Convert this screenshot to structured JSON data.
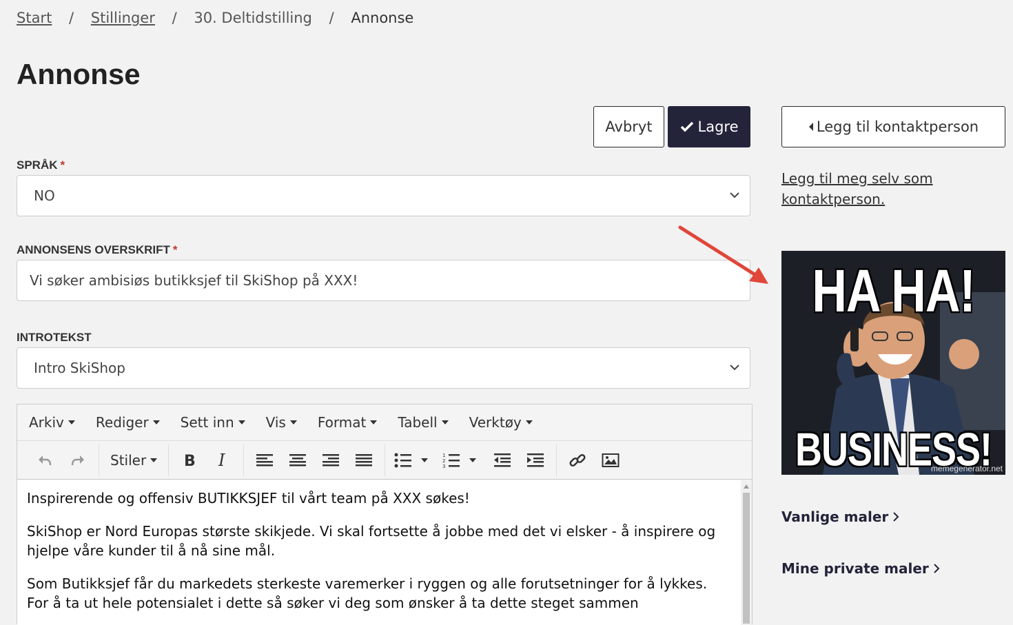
{
  "breadcrumb": {
    "items": [
      "Start",
      "Stillinger",
      "30. Deltidstilling",
      "Annonse"
    ],
    "separator": "/"
  },
  "page": {
    "title": "Annonse"
  },
  "actions": {
    "cancel_label": "Avbryt",
    "save_label": "Lagre",
    "add_contact_label": "Legg til kontaktperson",
    "add_self_link": "Legg til meg selv som kontaktperson."
  },
  "form": {
    "language": {
      "label": "SPRÅK",
      "required_mark": "*",
      "value": "NO"
    },
    "headline": {
      "label": "ANNONSENS OVERSKRIFT",
      "required_mark": "*",
      "value": "Vi søker ambisiøs butikksjef til SkiShop på XXX!"
    },
    "intro": {
      "label": "INTROTEKST",
      "value": "Intro SkiShop"
    }
  },
  "editor": {
    "menu": [
      "Arkiv",
      "Rediger",
      "Sett inn",
      "Vis",
      "Format",
      "Tabell",
      "Verktøy"
    ],
    "styles_label": "Stiler",
    "paragraphs": [
      "Inspirerende og offensiv BUTIKKSJEF til vårt team på XXX søkes!",
      "SkiShop er Nord Europas største skikjede. Vi skal fortsette å jobbe med det vi elsker - å inspirere og hjelpe våre kunder til å nå sine mål.",
      "Som Butikksjef får du markedets sterkeste varemerker i ryggen og alle forutsetninger for å lykkes. For å ta ut hele potensialet i dette så søker vi deg som ønsker å ta dette steget sammen"
    ]
  },
  "meme": {
    "top_text": "HA HA!",
    "bottom_text": "BUSINESS!",
    "watermark": "memegenerator.net"
  },
  "templates": {
    "common": "Vanlige maler",
    "private": "Mine private maler"
  },
  "colors": {
    "primary": "#23233a",
    "required": "#c0392b",
    "arrow": "#e0463a"
  }
}
